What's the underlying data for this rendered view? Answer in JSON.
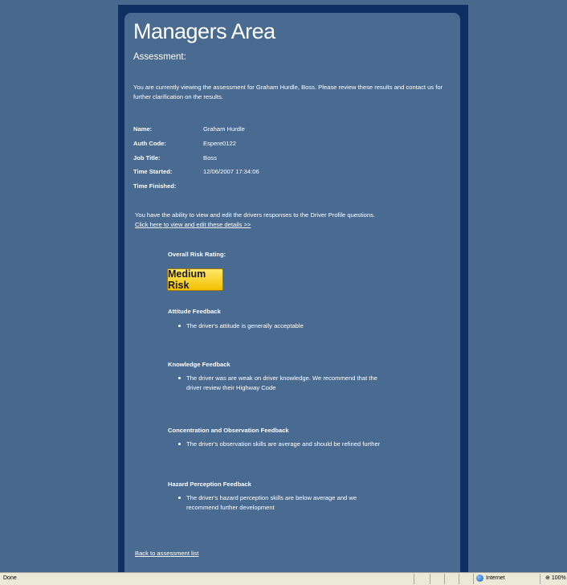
{
  "page": {
    "title": "Managers Area",
    "subtitle": "Assessment:",
    "intro": "You are currently viewing the assessment for Graham Hurdle, Boss. Please review these results and contact us for further clarification on the results."
  },
  "details": {
    "name_label": "Name:",
    "name_value": "Graham Hurdle",
    "auth_label": "Auth Code:",
    "auth_value": "Espere0122",
    "job_label": "Job Title:",
    "job_value": "Boss",
    "started_label": "Time Started:",
    "started_value": "12/06/2007 17:34:06",
    "finished_label": "Time Finished:",
    "finished_value": ""
  },
  "edit": {
    "text": "You have the ability to view and edit the drivers responses to the Driver Profile questions.",
    "link": "Click here to view and edit these details >>"
  },
  "risk": {
    "label": "Overall Risk Rating:",
    "value": "Medium Risk",
    "color": "#f2c000"
  },
  "feedback": {
    "attitude_head": "Attitude Feedback",
    "attitude_text": "The driver's attitude is generally acceptable",
    "knowledge_head": "Knowledge Feedback",
    "knowledge_text": "The driver was are weak on driver knowledge. We recommend that the driver review their Highway Code",
    "concentration_head": "Concentration and Observation Feedback",
    "concentration_text": "The driver's observation skills are average and should be refined further",
    "hazard_head": "Hazard Perception Feedback",
    "hazard_text": "The driver's hazard perception skills are below average and we recommend further development"
  },
  "footer": {
    "back_link": "Back to assessment list"
  },
  "statusbar": {
    "status": "Done",
    "zone": "Internet",
    "zoom": "100%",
    "zone_icon": "globe-icon"
  }
}
